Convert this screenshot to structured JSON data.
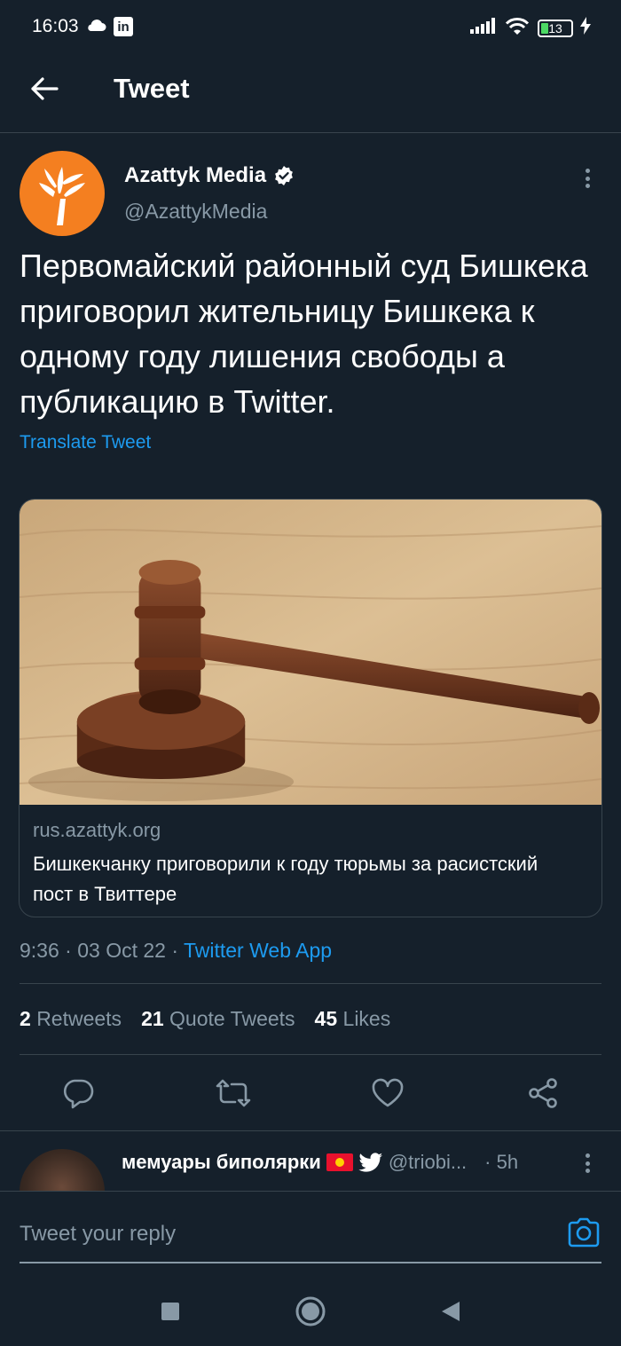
{
  "status_bar": {
    "time": "16:03",
    "battery_level": "13",
    "icons": [
      "cloud-icon",
      "linkedin-icon",
      "signal-icon",
      "wifi-icon",
      "battery-icon",
      "charging-icon"
    ]
  },
  "header": {
    "title": "Tweet"
  },
  "tweet": {
    "author_name": "Azattyk Media",
    "author_handle": "@AzattykMedia",
    "text": "Первомайский районный суд Бишкека приговорил жительницу Бишкека к одному году лишения свободы а публикацию в Twitter.",
    "translate_label": "Translate Tweet",
    "card": {
      "domain": "rus.azattyk.org",
      "title": "Бишкекчанку приговорили к году тюрьмы за расистский пост в Твиттере"
    },
    "time": "9:36",
    "date": "03 Oct 22",
    "source": "Twitter Web App",
    "separator": " · ",
    "stats": {
      "retweets_count": "2",
      "retweets_label": "Retweets",
      "quotes_count": "21",
      "quotes_label": "Quote Tweets",
      "likes_count": "45",
      "likes_label": "Likes"
    }
  },
  "reply_preview": {
    "name": "мемуары биполярки",
    "handle": "@triobi...",
    "time": "· 5h"
  },
  "composer": {
    "placeholder": "Tweet your reply"
  },
  "colors": {
    "background": "#15202b",
    "accent": "#1d9bf0",
    "muted": "#8899a6",
    "avatar": "#f47f20"
  }
}
